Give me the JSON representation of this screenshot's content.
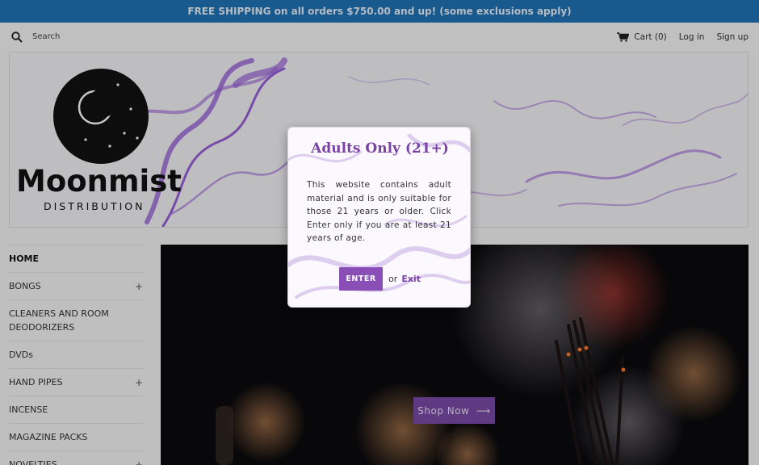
{
  "announcement": "FREE SHIPPING on all orders $750.00 and up! (some exclusions apply)",
  "topbar": {
    "search_label": "Search",
    "cart_label": "Cart",
    "cart_count": "(0)",
    "login_label": "Log in",
    "signup_label": "Sign up"
  },
  "logo": {
    "brand": "Moonmist",
    "sub": "DISTRIBUTION"
  },
  "sidebar": {
    "items": [
      {
        "label": "HOME",
        "expandable": ""
      },
      {
        "label": "BONGS",
        "expandable": "+"
      },
      {
        "label": "CLEANERS AND ROOM DEODORIZERS",
        "expandable": ""
      },
      {
        "label": "DVDs",
        "expandable": ""
      },
      {
        "label": "HAND PIPES",
        "expandable": "+"
      },
      {
        "label": "INCENSE",
        "expandable": ""
      },
      {
        "label": "MAGAZINE PACKS",
        "expandable": ""
      },
      {
        "label": "NOVELTIES",
        "expandable": "+"
      }
    ]
  },
  "hero": {
    "cta_label": "Shop Now",
    "cta_arrow": "⟶"
  },
  "age_gate": {
    "title": "Adults Only (21+)",
    "message": "This website contains adult material and is only suitable for those 21 years or older. Click Enter only if you are at least 21 years of age.",
    "enter_label": "ENTER",
    "or_label": "or",
    "exit_label": "Exit"
  },
  "colors": {
    "announcement_bg": "#1f73b7",
    "accent": "#7a43a3",
    "button": "#8a4fb7"
  }
}
